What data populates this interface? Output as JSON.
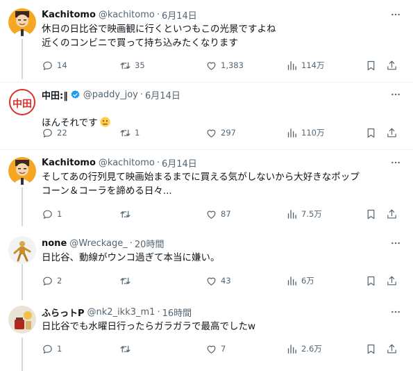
{
  "tweets": [
    {
      "name": "Kachitomo",
      "handle": "@kachitomo",
      "dot": "·",
      "time": "6月14日",
      "text": "休日の日比谷で映画観に行くといつもこの光景ですよね\n近くのコンビニで買って持ち込みたくなります",
      "replies": "14",
      "retweets": "35",
      "likes": "1,383",
      "views": "114万"
    },
    {
      "name": "中田:‖",
      "handle": "@paddy_joy",
      "dot": "·",
      "time": "6月14日",
      "text": "ほんそれです",
      "replies": "22",
      "retweets": "1",
      "likes": "297",
      "views": "110万"
    },
    {
      "name": "Kachitomo",
      "handle": "@kachitomo",
      "dot": "·",
      "time": "6月14日",
      "text": "そしてあの行列見て映画始まるまでに買える気がしないから大好きなポップ\nコーン＆コーラを諦める日々...",
      "replies": "1",
      "retweets": "",
      "likes": "87",
      "views": "7.5万"
    },
    {
      "name": "none",
      "handle": "@Wreckage_",
      "dot": "·",
      "time": "20時間",
      "text": "日比谷、動線がウンコ過ぎて本当に嫌い。",
      "replies": "2",
      "retweets": "",
      "likes": "43",
      "views": "6万"
    },
    {
      "name": "ふらっトP",
      "handle": "@nk2_ikk3_m1",
      "dot": "·",
      "time": "16時間",
      "text": "日比谷でも水曜日行ったらガラガラで最高でしたw",
      "replies": "1",
      "retweets": "",
      "likes": "7",
      "views": "2.6万"
    }
  ],
  "avatar_text": {
    "nakata": "中田"
  },
  "icons": {
    "more": "more-icon",
    "reply": "reply-icon",
    "retweet": "retweet-icon",
    "like": "heart-icon",
    "views": "views-icon",
    "bookmark": "bookmark-icon",
    "share": "share-icon",
    "verified": "verified-badge-icon",
    "emoji": "thinking-face-emoji"
  },
  "colors": {
    "text": "#0f1419",
    "secondary": "#536471",
    "verified": "#1d9bf0",
    "divider": "#eff3f4",
    "thread_line": "#cfd9de"
  }
}
